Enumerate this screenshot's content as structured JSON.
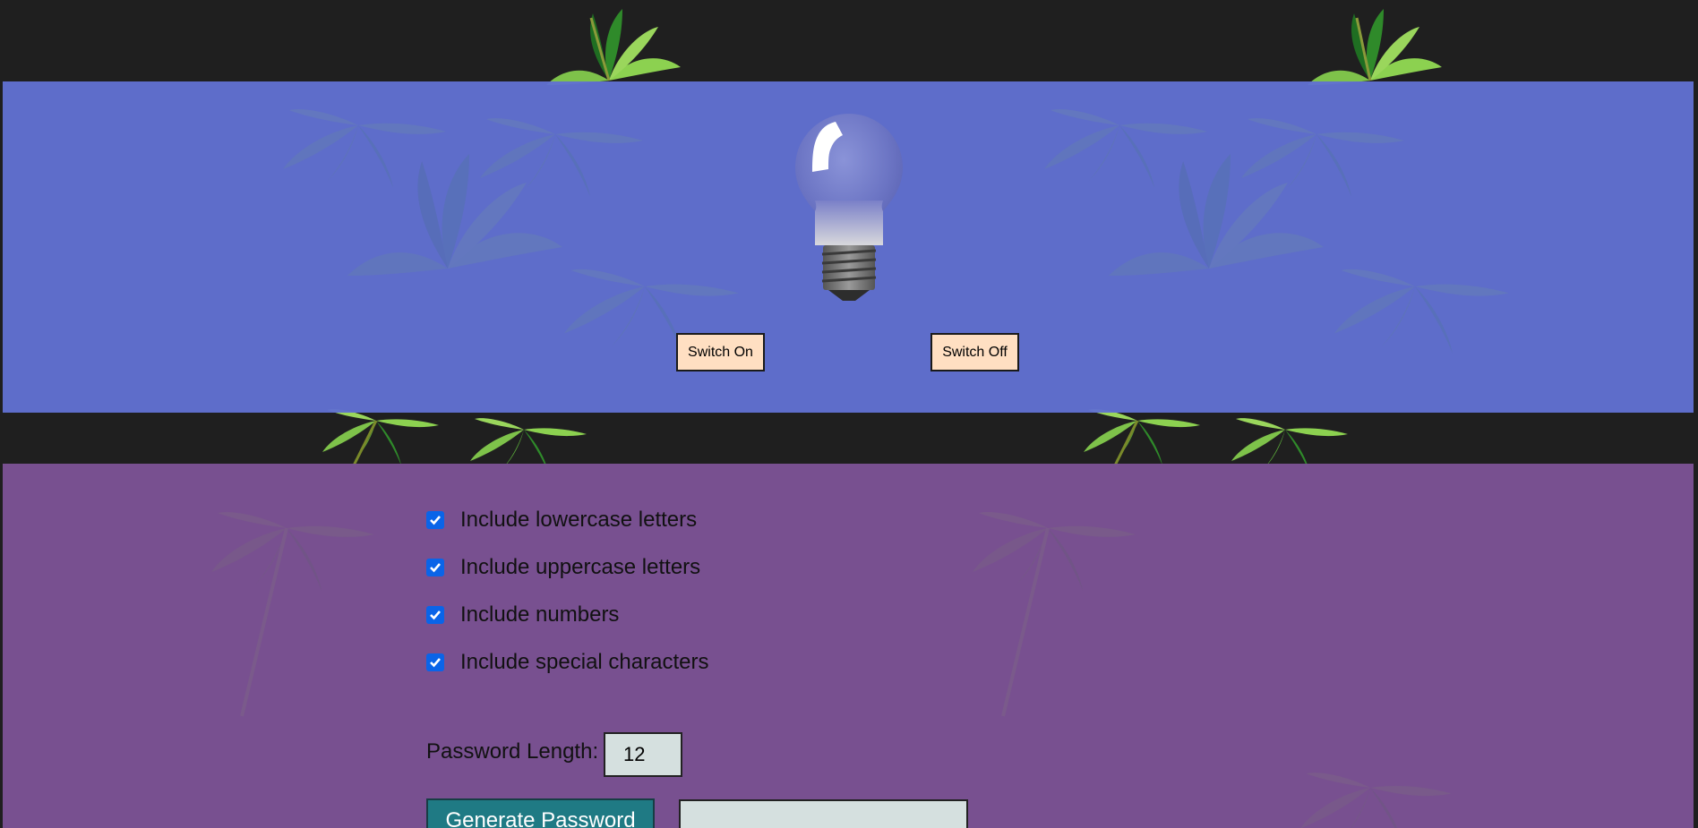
{
  "bulb_controls": {
    "on_label": "Switch On",
    "off_label": "Switch Off"
  },
  "generator": {
    "options": [
      {
        "label": "Include lowercase letters",
        "checked": true
      },
      {
        "label": "Include uppercase letters",
        "checked": true
      },
      {
        "label": "Include numbers",
        "checked": true
      },
      {
        "label": "Include special characters",
        "checked": true
      }
    ],
    "length_label": "Password Length:",
    "length_value": "12",
    "generate_label": "Generate Password",
    "output_value": ""
  },
  "colors": {
    "bulb_panel": "#6170d1",
    "generator_panel": "#7b5294",
    "page_bg": "#1f1f1f",
    "switch_button": "#ffdfc2",
    "generate_button": "#1f7a84",
    "checkbox": "#0a64e8"
  },
  "icons": [
    "light-bulb-icon",
    "checkbox-checked-icon",
    "bamboo-leaves-decoration"
  ]
}
